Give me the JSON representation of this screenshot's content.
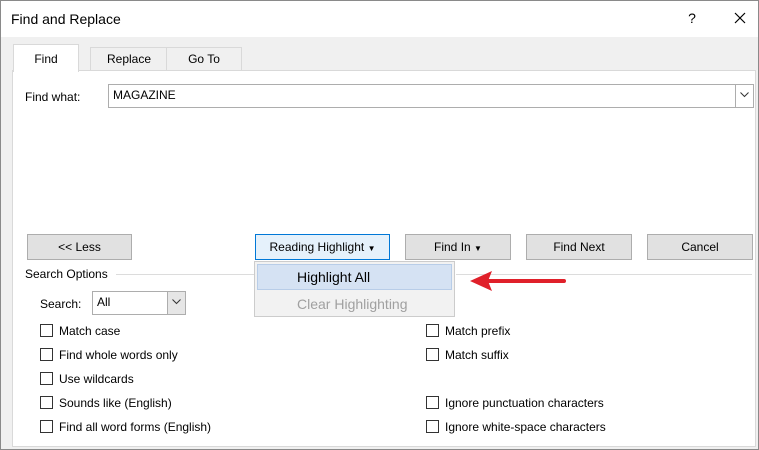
{
  "window": {
    "title": "Find and Replace",
    "help": "?"
  },
  "tabs": [
    {
      "label": "Find",
      "active": true
    },
    {
      "label": "Replace",
      "active": false
    },
    {
      "label": "Go To",
      "active": false
    }
  ],
  "find": {
    "label": "Find what:",
    "value": "MAGAZINE"
  },
  "buttons": {
    "less": "<< Less",
    "reading_highlight": "Reading Highlight",
    "find_in": "Find In",
    "find_next": "Find Next",
    "cancel": "Cancel"
  },
  "menu": {
    "highlight_all": "Highlight All",
    "clear_highlighting": "Clear Highlighting"
  },
  "search_options": {
    "heading": "Search Options",
    "search_label": "Search:",
    "search_value": "All",
    "left": [
      {
        "label": "Match case",
        "checked": false
      },
      {
        "label": "Find whole words only",
        "checked": false
      },
      {
        "label": "Use wildcards",
        "checked": false
      },
      {
        "label": "Sounds like (English)",
        "checked": false
      },
      {
        "label": "Find all word forms (English)",
        "checked": false
      }
    ],
    "right": [
      {
        "label": "Match prefix",
        "checked": false
      },
      {
        "label": "Match suffix",
        "checked": false
      },
      {
        "label": "Ignore punctuation characters",
        "checked": false
      },
      {
        "label": "Ignore white-space characters",
        "checked": false
      }
    ]
  },
  "colors": {
    "annotation_arrow": "#e0202a",
    "menu_hover": "#d5e2f3",
    "focus_border": "#0078d7"
  }
}
